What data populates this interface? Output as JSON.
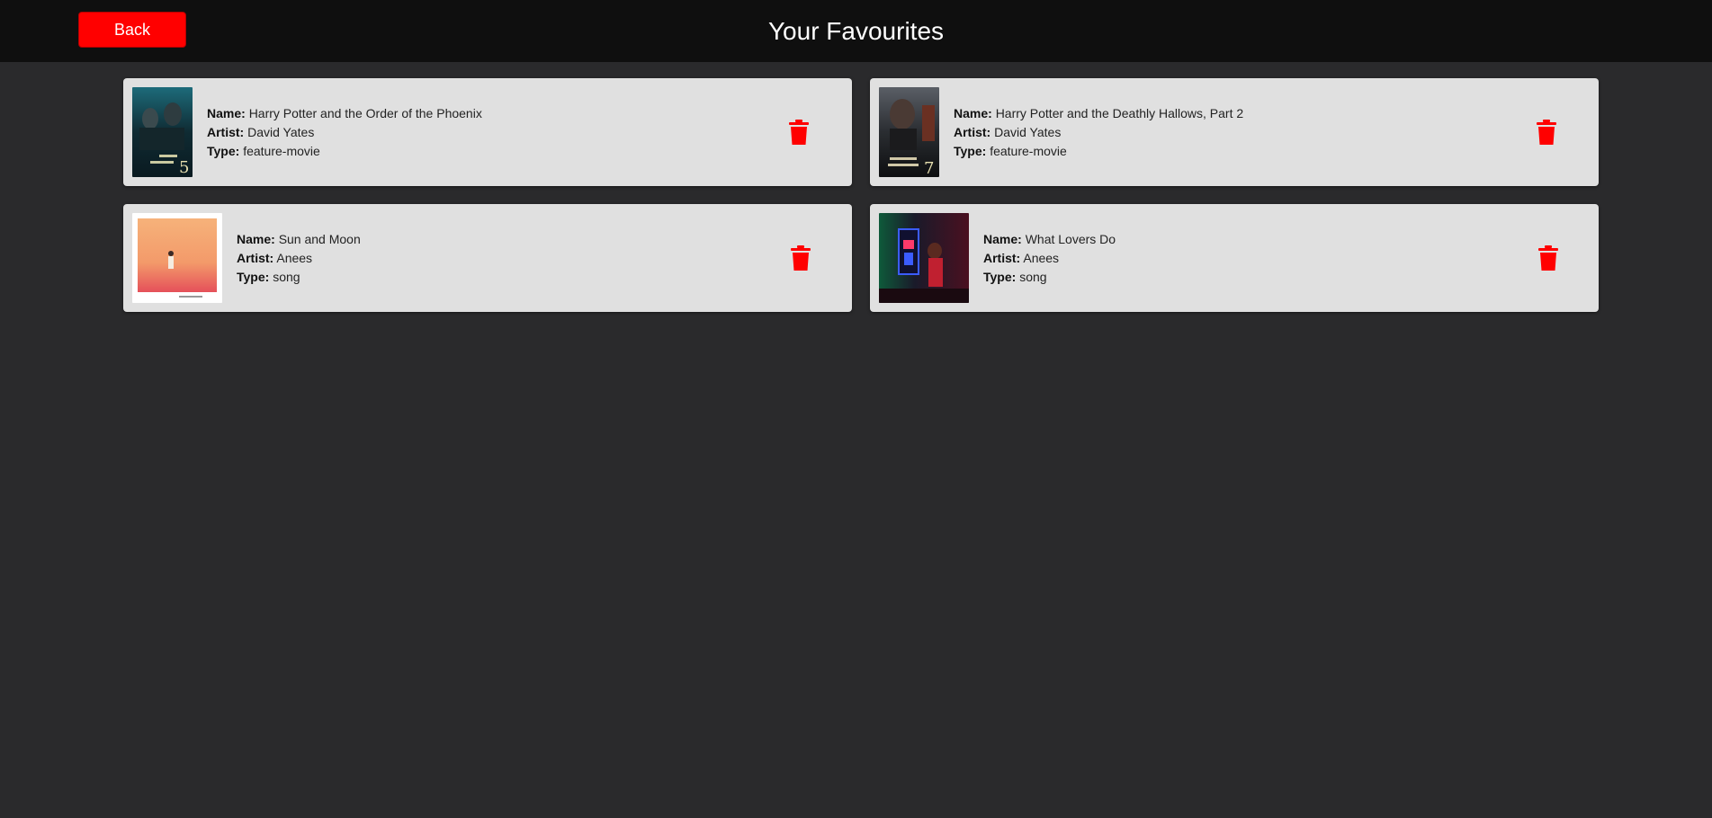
{
  "header": {
    "back_label": "Back",
    "title": "Your Favourites"
  },
  "labels": {
    "name": "Name:",
    "artist": "Artist:",
    "type": "Type:"
  },
  "favourites": [
    {
      "name": "Harry Potter and the Order of the Phoenix",
      "artist": "David Yates",
      "type": "feature-movie"
    },
    {
      "name": "Harry Potter and the Deathly Hallows, Part 2",
      "artist": "David Yates",
      "type": "feature-movie"
    },
    {
      "name": "Sun and Moon",
      "artist": "Anees",
      "type": "song"
    },
    {
      "name": "What Lovers Do",
      "artist": "Anees",
      "type": "song"
    }
  ],
  "icons": {
    "delete": "trash-icon"
  },
  "colors": {
    "accent": "#ff0000",
    "background": "#2a2a2c",
    "header": "#0f0f0f",
    "card": "#e0e0e0"
  }
}
